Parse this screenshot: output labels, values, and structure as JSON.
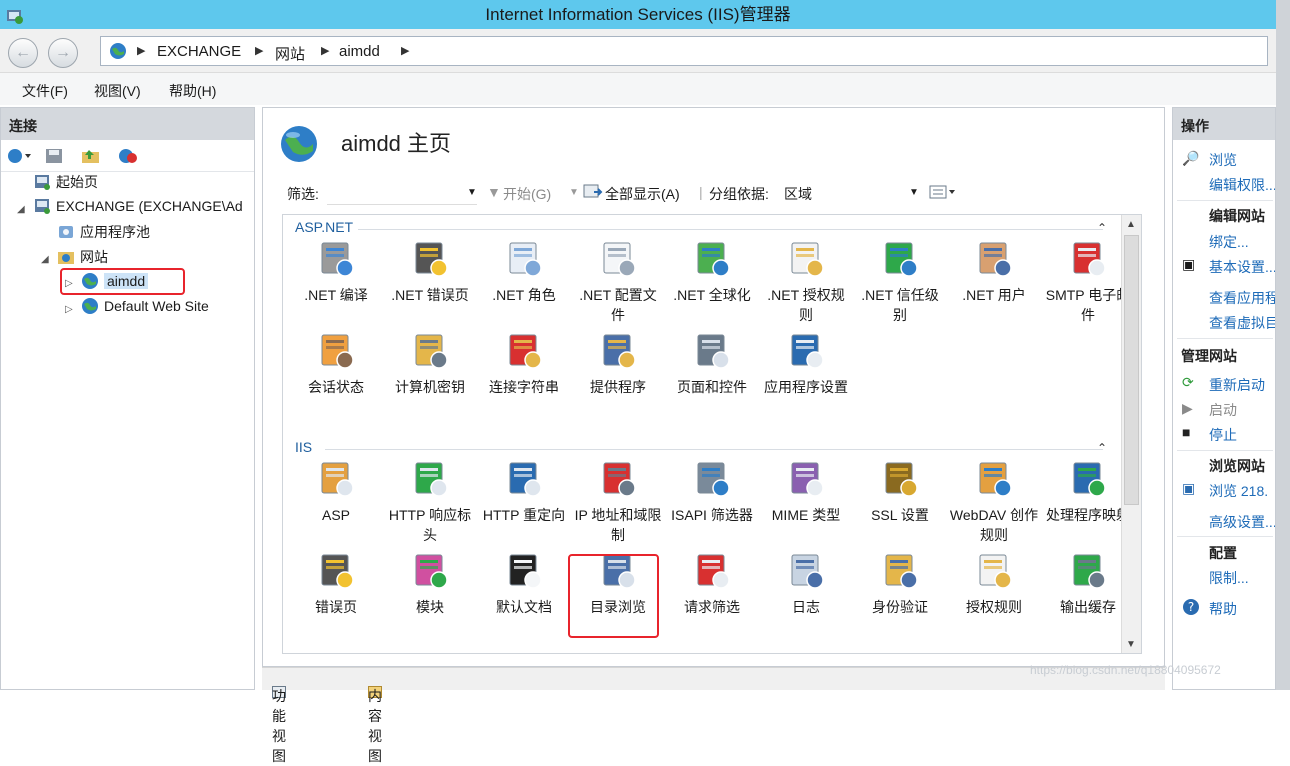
{
  "window": {
    "title": "Internet Information Services (IIS)管理器"
  },
  "address": {
    "segments": [
      "EXCHANGE",
      "网站",
      "aimdd"
    ]
  },
  "menu": {
    "file": "文件(F)",
    "view": "视图(V)",
    "help": "帮助(H)"
  },
  "connections": {
    "header": "连接",
    "tree": {
      "start_page": "起始页",
      "server": "EXCHANGE (EXCHANGE\\Ad",
      "app_pools": "应用程序池",
      "sites": "网站",
      "aimdd": "aimdd",
      "default_site": "Default Web Site"
    }
  },
  "main": {
    "title": "aimdd 主页",
    "filter": {
      "label": "筛选:",
      "start": "开始(G)",
      "show_all": "全部显示(A)",
      "group_by_label": "分组依据:",
      "group_by_value": "区域"
    },
    "sections": [
      {
        "name": "ASP.NET",
        "items": [
          {
            "label": ".NET 编译",
            "icon": "net-compilation-icon"
          },
          {
            "label": ".NET 错误页",
            "icon": "net-error-pages-icon"
          },
          {
            "label": ".NET 角色",
            "icon": "net-roles-icon"
          },
          {
            "label": ".NET 配置文件",
            "icon": "net-profile-icon"
          },
          {
            "label": ".NET 全球化",
            "icon": "net-globalization-icon"
          },
          {
            "label": ".NET 授权规则",
            "icon": "net-authorization-icon"
          },
          {
            "label": ".NET 信任级别",
            "icon": "net-trust-levels-icon"
          },
          {
            "label": ".NET 用户",
            "icon": "net-users-icon"
          },
          {
            "label": "SMTP 电子邮件",
            "icon": "smtp-email-icon"
          },
          {
            "label": "会话状态",
            "icon": "session-state-icon"
          },
          {
            "label": "计算机密钥",
            "icon": "machine-key-icon"
          },
          {
            "label": "连接字符串",
            "icon": "connection-strings-icon"
          },
          {
            "label": "提供程序",
            "icon": "providers-icon"
          },
          {
            "label": "页面和控件",
            "icon": "pages-controls-icon"
          },
          {
            "label": "应用程序设置",
            "icon": "app-settings-icon"
          }
        ]
      },
      {
        "name": "IIS",
        "items": [
          {
            "label": "ASP",
            "icon": "asp-icon"
          },
          {
            "label": "HTTP 响应标头",
            "icon": "http-response-headers-icon"
          },
          {
            "label": "HTTP 重定向",
            "icon": "http-redirect-icon"
          },
          {
            "label": "IP 地址和域限制",
            "icon": "ip-restrictions-icon"
          },
          {
            "label": "ISAPI 筛选器",
            "icon": "isapi-filters-icon"
          },
          {
            "label": "MIME 类型",
            "icon": "mime-types-icon"
          },
          {
            "label": "SSL 设置",
            "icon": "ssl-settings-icon"
          },
          {
            "label": "WebDAV 创作规则",
            "icon": "webdav-icon"
          },
          {
            "label": "处理程序映射",
            "icon": "handler-mappings-icon"
          },
          {
            "label": "错误页",
            "icon": "error-pages-icon"
          },
          {
            "label": "模块",
            "icon": "modules-icon"
          },
          {
            "label": "默认文档",
            "icon": "default-document-icon"
          },
          {
            "label": "目录浏览",
            "icon": "directory-browsing-icon"
          },
          {
            "label": "请求筛选",
            "icon": "request-filtering-icon"
          },
          {
            "label": "日志",
            "icon": "logging-icon"
          },
          {
            "label": "身份验证",
            "icon": "authentication-icon"
          },
          {
            "label": "授权规则",
            "icon": "authorization-rules-icon"
          },
          {
            "label": "输出缓存",
            "icon": "output-caching-icon"
          }
        ]
      }
    ]
  },
  "bottom_tabs": {
    "features": "功能视图",
    "content": "内容视图"
  },
  "actions": {
    "header": "操作",
    "browse": "浏览",
    "edit_permissions": "编辑权限...",
    "edit_site_group": "编辑网站",
    "bindings": "绑定...",
    "basic_settings": "基本设置...",
    "view_apps": "查看应用程",
    "view_vdirs": "查看虚拟目",
    "manage_site_group": "管理网站",
    "restart": "重新启动",
    "start": "启动",
    "stop": "停止",
    "browse_site_group": "浏览网站",
    "browse_218": "浏览 218.",
    "advanced_settings": "高级设置...",
    "config_group": "配置",
    "limits": "限制...",
    "help": "帮助"
  },
  "watermark": "https://blog.csdn.net/q18804095672",
  "colors": {
    "titlebar": "#5ec8ed",
    "highlight": "#e8242c",
    "link": "#1e6bb8"
  }
}
